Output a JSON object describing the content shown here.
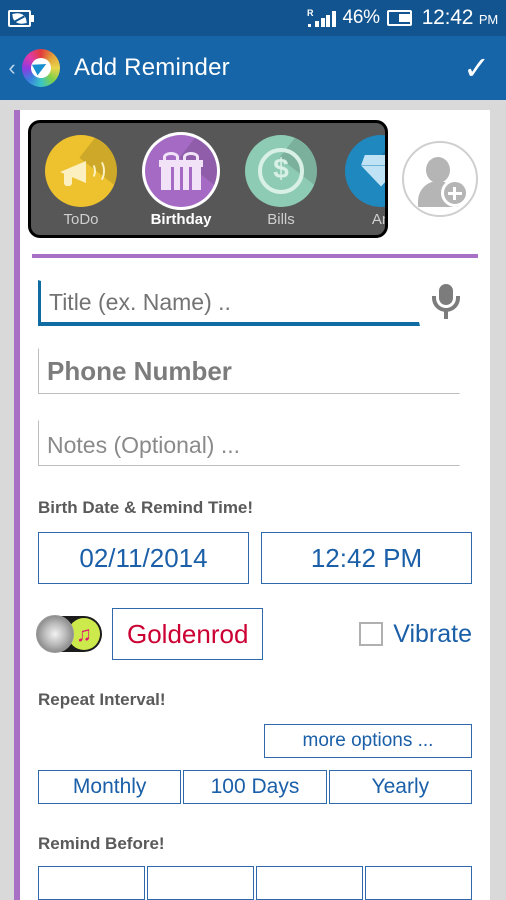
{
  "status_bar": {
    "left_icon": "eco-battery-icon",
    "roaming_label": "R",
    "battery_percent": "46%",
    "time": "12:42",
    "ampm": "PM"
  },
  "app_bar": {
    "back_label": "‹",
    "logo_icon": "app-logo-icon",
    "title": "Add Reminder",
    "confirm_label": "✓"
  },
  "categories": {
    "items": [
      {
        "label": "ToDo",
        "icon": "megaphone-icon",
        "color": "#edc22e",
        "selected": false
      },
      {
        "label": "Birthday",
        "icon": "gift-icon",
        "color": "#a56bc4",
        "selected": true
      },
      {
        "label": "Bills",
        "icon": "dollar-coin-icon",
        "color": "#8ecbb4",
        "selected": false
      },
      {
        "label": "An",
        "icon": "diamond-icon",
        "color": "#1f88bf",
        "selected": false
      }
    ],
    "add_contact_label": "add-contact"
  },
  "form": {
    "title_placeholder": "Title (ex. Name) ..",
    "title_value": "",
    "mic_icon": "microphone-icon",
    "phone_placeholder": "Phone Number",
    "phone_value": "",
    "notes_placeholder": "Notes (Optional) ...",
    "notes_value": ""
  },
  "datetime": {
    "label": "Birth Date & Remind Time!",
    "date": "02/11/2014",
    "time": "12:42 PM"
  },
  "tone": {
    "toggle_icon": "ringtone-toggle-icon",
    "note_icon": "music-note-icon",
    "ringtone_name": "Goldenrod",
    "vibrate_label": "Vibrate",
    "vibrate_checked": false
  },
  "repeat": {
    "label": "Repeat Interval!",
    "more_options_label": "more options ...",
    "options": [
      "Monthly",
      "100 Days",
      "Yearly"
    ]
  },
  "remind_before": {
    "label": "Remind Before!",
    "options": [
      "",
      "",
      "",
      ""
    ]
  },
  "colors": {
    "status_bar": "#12548f",
    "app_bar": "#1565a8",
    "accent_purple": "#a971c6",
    "accent_blue": "#1a5fa8",
    "ringtone_red": "#cc0033",
    "page_background": "#d9d9d9"
  }
}
